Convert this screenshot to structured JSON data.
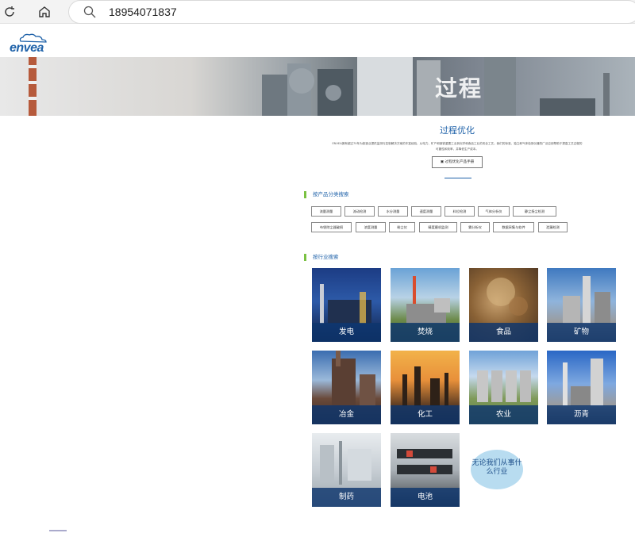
{
  "browser": {
    "url": "18954071837"
  },
  "brand": {
    "logo_text": "envea",
    "accent": "#1f62a9",
    "green": "#7ac142"
  },
  "banner": {
    "title": "过程"
  },
  "main": {
    "title": "过程优化",
    "intro": "ENVEA拥有超过70年为制造业提供监测与控制解决方案的丰富经验，从电力、矿产和钢铁重要工业到化学和食品工业的安全工艺。我们的标准、独立和气体检测仪器的广泛应用帮助于提高工艺过程的可靠性和效率，并降低生产成本。",
    "catalog_button": "过程优化产品手册"
  },
  "product_search": {
    "heading": "按产品分类搜索",
    "chips_row1": [
      "流量测量",
      "流动检测",
      "水分测量",
      "速度测量",
      "料位检测",
      "气体分析仪",
      "静尘扬尘检测"
    ],
    "chips_row2": [
      "布袋除尘器破损",
      "浓度测量",
      "粉尘仪",
      "精度磨机监测",
      "雾分析仪",
      "数据采集与软件",
      "泄漏检测"
    ]
  },
  "industry_search": {
    "heading": "按行业搜索",
    "tiles": [
      {
        "label": "发电"
      },
      {
        "label": "焚烧"
      },
      {
        "label": "食品"
      },
      {
        "label": "矿物"
      },
      {
        "label": "冶金"
      },
      {
        "label": "化工"
      },
      {
        "label": "农业"
      },
      {
        "label": "沥青"
      },
      {
        "label": "制药"
      },
      {
        "label": "电池"
      }
    ],
    "other_bubble": "无论我们从事什么行业"
  }
}
